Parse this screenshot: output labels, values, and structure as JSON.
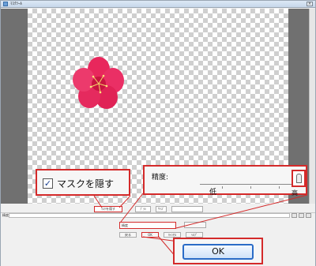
{
  "window": {
    "title": "ﾏｽｸﾂｰﾙ",
    "close": "×"
  },
  "callouts": {
    "hide_mask": {
      "label": "マスクを隠す",
      "checked": true,
      "check_glyph": "✓"
    },
    "precision": {
      "label": "精度:",
      "low": "低",
      "high": "高"
    },
    "ok": {
      "label": "OK"
    }
  },
  "toolbar": {
    "hide_mask_small": "ﾏｽｸを隠す",
    "tool_a": "ﾌﾞﾗｼ",
    "tool_b": "ｻｲｽﾞ"
  },
  "panel": {
    "field_label": "精度",
    "mini_input_value": "精度",
    "buttons": {
      "ok": "OK",
      "cancel": "ｷｬﾝｾﾙ",
      "help": "ﾍﾙﾌﾟ",
      "prev": "戻る"
    }
  },
  "colors": {
    "callout_border": "#d42a2a",
    "ok_border": "#2b6cc7",
    "flower": "#e8275c"
  },
  "icons": [
    "checkbox-icon",
    "slider-knob-icon",
    "close-icon",
    "app-icon"
  ]
}
